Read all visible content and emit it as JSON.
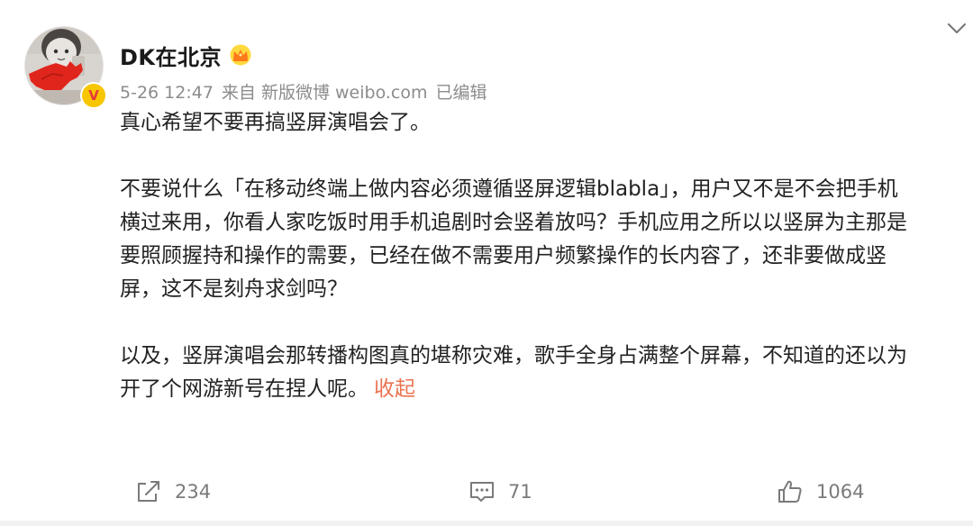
{
  "post": {
    "username": "DK在北京",
    "meta": {
      "time": "5-26 12:47",
      "source": "来自 新版微博 weibo.com",
      "edited": "已编辑"
    },
    "verified_badge": "V",
    "content": {
      "p1": "真心希望不要再搞竖屏演唱会了。",
      "p2_line1": "不要说什么「在移动终端上做内容必须遵循竖屏逻辑blabla」，用户又不是不会把手机",
      "p2_line2": "横过来用，你看人家吃饭时用手机追剧时会竖着放吗？手机应用之所以以竖屏为主那是",
      "p2_line3": "要照顾握持和操作的需要，已经在做不需要用户频繁操作的长内容了，还非要做成竖",
      "p2_line4": "屏，这不是刻舟求剑吗？",
      "p3_line1": "以及，竖屏演唱会那转播构图真的堪称灾难，歌手全身占满整个屏幕，不知道的还以为",
      "p3_line2": "开了个网游新号在捏人呢。",
      "collapse_label": "收起"
    },
    "actions": {
      "share_count": "234",
      "comment_count": "71",
      "like_count": "1064"
    }
  },
  "icons": {
    "crown": "crown-icon",
    "chevron": "chevron-down-icon",
    "share": "share-icon",
    "comment": "comment-icon",
    "like": "thumbs-up-icon"
  },
  "colors": {
    "accent_link": "#eb7350",
    "meta_gray": "#8c8c8c",
    "verified_yellow": "#f7c600",
    "verified_red": "#e4393c"
  }
}
